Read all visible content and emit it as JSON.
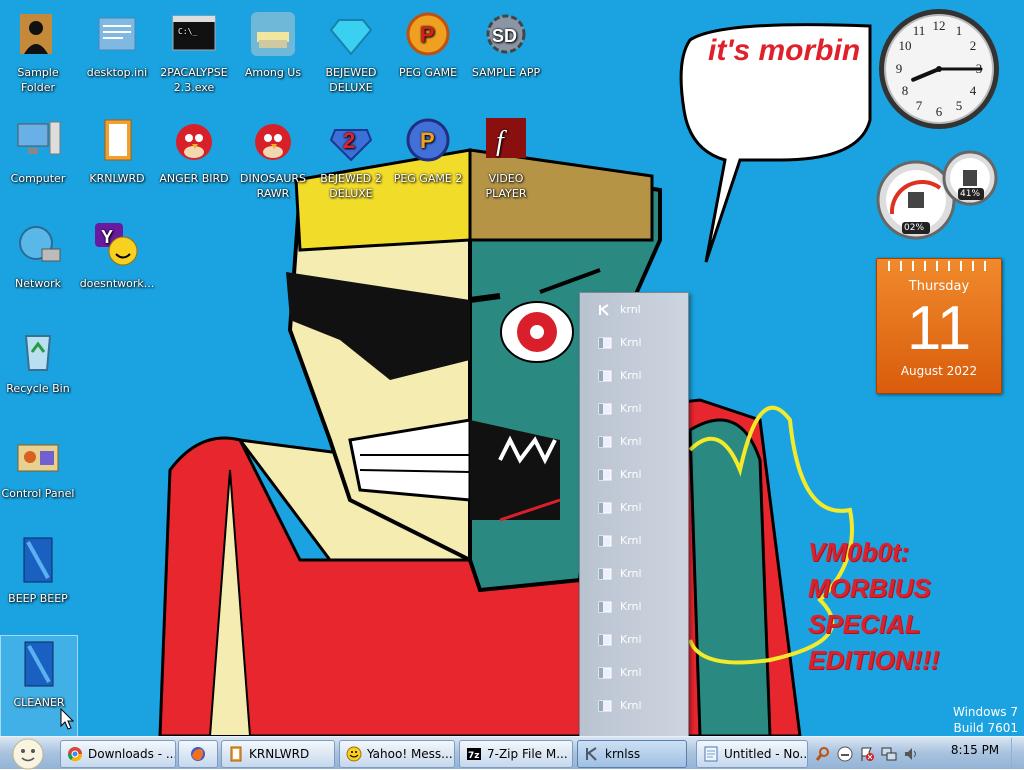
{
  "desktop": {
    "icons": [
      {
        "label": "Sample Folder",
        "icon": "person-silhouette-icon"
      },
      {
        "label": "desktop.ini",
        "icon": "ini-file-icon"
      },
      {
        "label": "2PACALYPSE 2.3.exe",
        "icon": "console-exe-icon"
      },
      {
        "label": "Among Us",
        "icon": "among-us-icon"
      },
      {
        "label": "BEJEWED DELUXE",
        "icon": "bejeweled-gem-icon"
      },
      {
        "label": "PEG GAME",
        "icon": "peggle-icon"
      },
      {
        "label": "SAMPLE APP",
        "icon": "sd-gear-icon"
      },
      {
        "label": "Computer",
        "icon": "computer-icon"
      },
      {
        "label": "KRNLWRD",
        "icon": "word-file-icon"
      },
      {
        "label": "ANGER BIRD",
        "icon": "angry-bird-icon"
      },
      {
        "label": "DINOSAURS RAWR",
        "icon": "angry-bird-icon"
      },
      {
        "label": "BEJEWED 2 DELUXE",
        "icon": "bejeweled2-icon"
      },
      {
        "label": "PEG GAME 2",
        "icon": "peggle-nights-icon"
      },
      {
        "label": "VIDEO PLAYER",
        "icon": "flash-player-icon"
      },
      {
        "label": "Network",
        "icon": "network-globe-icon"
      },
      {
        "label": "doesntwork...",
        "icon": "yahoo-messenger-icon"
      },
      {
        "label": "Recycle Bin",
        "icon": "recycle-bin-icon"
      },
      {
        "label": "Control Panel",
        "icon": "control-panel-icon"
      },
      {
        "label": "BEEP BEEP",
        "icon": "blue-app-icon"
      },
      {
        "label": "CLEANER",
        "icon": "blue-app-icon"
      }
    ]
  },
  "wallpaper": {
    "speech_bubble": "it's morbin",
    "caption_lines": [
      "VM0b0t:",
      "MORBIUS",
      "SPECIAL",
      "EDITION!!!"
    ]
  },
  "gadgets": {
    "clock": {
      "hour": 8,
      "minute": 15
    },
    "meter": {
      "cpu": "02%",
      "memory": "41%"
    },
    "calendar": {
      "weekday": "Thursday",
      "day": "11",
      "month_year": "August 2022"
    }
  },
  "watermark": {
    "line1": "Windows 7",
    "line2": "Build 7601"
  },
  "popup_menu": {
    "items": [
      "krnl",
      "Krnl",
      "Krnl",
      "Krnl",
      "Krnl",
      "Krnl",
      "Krnl",
      "Krnl",
      "Krnl",
      "Krnl",
      "Krnl",
      "Krnl",
      "Krnl"
    ]
  },
  "taskbar": {
    "buttons": [
      {
        "label": "Downloads - ...",
        "icon": "chrome-icon"
      },
      {
        "label": "",
        "icon": "firefox-icon"
      },
      {
        "label": "KRNLWRD",
        "icon": "folder-icon"
      },
      {
        "label": "Yahoo! Mess...",
        "icon": "yahoo-icon"
      },
      {
        "label": "7-Zip File M...",
        "icon": "7zip-icon"
      },
      {
        "label": "krnlss",
        "icon": "krnl-icon"
      },
      {
        "label": "Untitled - No...",
        "icon": "notepad-icon"
      }
    ],
    "clock": "8:15 PM"
  },
  "colors": {
    "desktop": "#1aa3e0",
    "calendar": "#e8761e",
    "caption": "#d8222e"
  }
}
